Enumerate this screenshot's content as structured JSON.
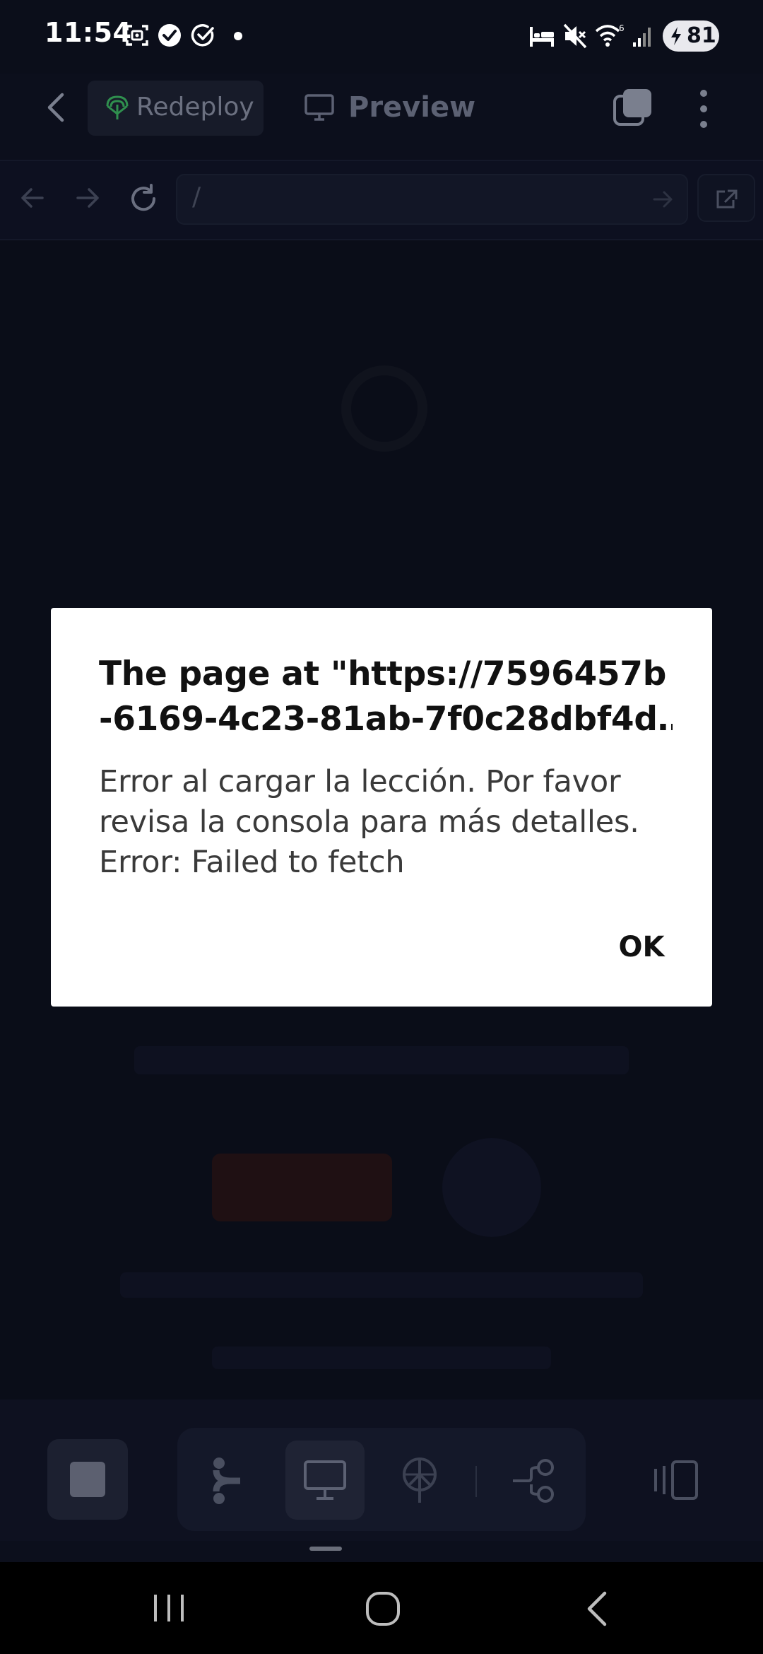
{
  "status_bar": {
    "time": "11:54",
    "battery_level": "81",
    "icons": [
      "screenshot-icon",
      "check-circle-filled-icon",
      "check-circle-outline-icon",
      "dot-icon",
      "bed-icon",
      "mute-icon",
      "wifi-6-icon",
      "signal-icon",
      "charging-icon"
    ]
  },
  "header": {
    "redeploy_label": "Redeploy",
    "preview_label": "Preview"
  },
  "browser": {
    "url": "/"
  },
  "dialog": {
    "title_line1": "The page at \"https://7596457b",
    "title_line2": "-6169-4c23-81ab-7f0c28dbf4d…",
    "message_line1": "Error al cargar la lección. Por favor",
    "message_line2": "revisa la consola para más detalles.",
    "message_line3": "Error: Failed to fetch",
    "ok_label": "OK"
  },
  "colors": {
    "background": "#0c0f1c",
    "dialog_bg": "#ffffff",
    "accent_green": "#2f8f4e"
  }
}
